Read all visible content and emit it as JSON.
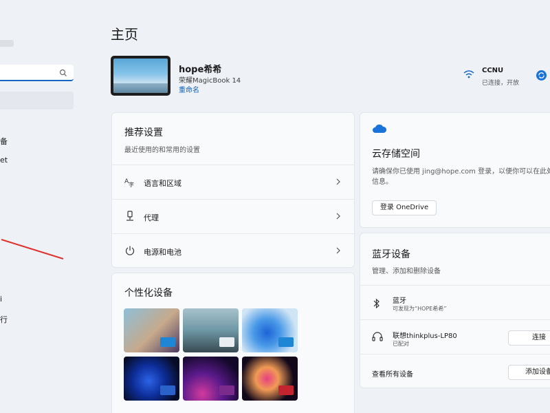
{
  "sidebar": {
    "items": [
      {
        "label": "备"
      },
      {
        "label": "et"
      },
      {
        "label": "i"
      },
      {
        "label": "行"
      }
    ]
  },
  "page": {
    "title": "主页"
  },
  "device": {
    "name": "hope希希",
    "model": "荣耀MagicBook 14",
    "rename_label": "重命名"
  },
  "network": {
    "name": "CCNU",
    "status": "已连接，开放"
  },
  "recommended": {
    "title": "推荐设置",
    "subtitle": "最近使用的和常用的设置",
    "items": [
      {
        "label": "语言和区域",
        "icon": "language-icon"
      },
      {
        "label": "代理",
        "icon": "proxy-icon"
      },
      {
        "label": "电源和电池",
        "icon": "power-icon"
      }
    ]
  },
  "personalize": {
    "title": "个性化设备"
  },
  "cloud": {
    "title": "云存储空间",
    "desc_line1": "请确保你已使用 jing@hope.com 登录，以便你可以在此处",
    "desc_line2": "信息。",
    "button": "登录 OneDrive"
  },
  "bluetooth": {
    "title": "蓝牙设备",
    "subtitle": "管理、添加和删除设备",
    "bt_name": "蓝牙",
    "bt_status": "可发现为“HOPE希希”",
    "headset_name": "联想thinkplus-LP80",
    "headset_status": "已配对",
    "connect_label": "连接",
    "view_all_label": "查看所有设备",
    "add_device_label": "添加设备"
  },
  "colors": {
    "accent": "#1566c0",
    "link": "#0f5fb8",
    "background": "#eef2f7",
    "card": "#f9fafc"
  }
}
